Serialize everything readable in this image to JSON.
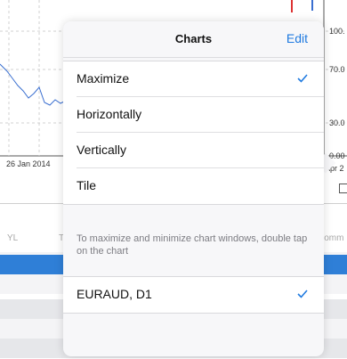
{
  "background": {
    "chart": {
      "y_ticks": [
        "100.",
        "70.0",
        "30.0",
        "0.00"
      ],
      "x_tick_left": "26 Jan 2014",
      "x_tick_right": "0 Apr 2"
    },
    "table": {
      "header_left": "YL",
      "header_mid": "T",
      "header_right": "Comm"
    }
  },
  "popover": {
    "title": "Charts",
    "edit_label": "Edit",
    "layout_options": [
      {
        "label": "Maximize",
        "checked": true
      },
      {
        "label": "Horizontally",
        "checked": false
      },
      {
        "label": "Vertically",
        "checked": false
      },
      {
        "label": "Tile",
        "checked": false
      }
    ],
    "hint": "To maximize and minimize chart windows, double tap on the chart",
    "charts": [
      {
        "label": "EURAUD, D1",
        "checked": true
      }
    ]
  },
  "colors": {
    "accent": "#1f7ae0",
    "selection_row": "#2f7fd7"
  }
}
